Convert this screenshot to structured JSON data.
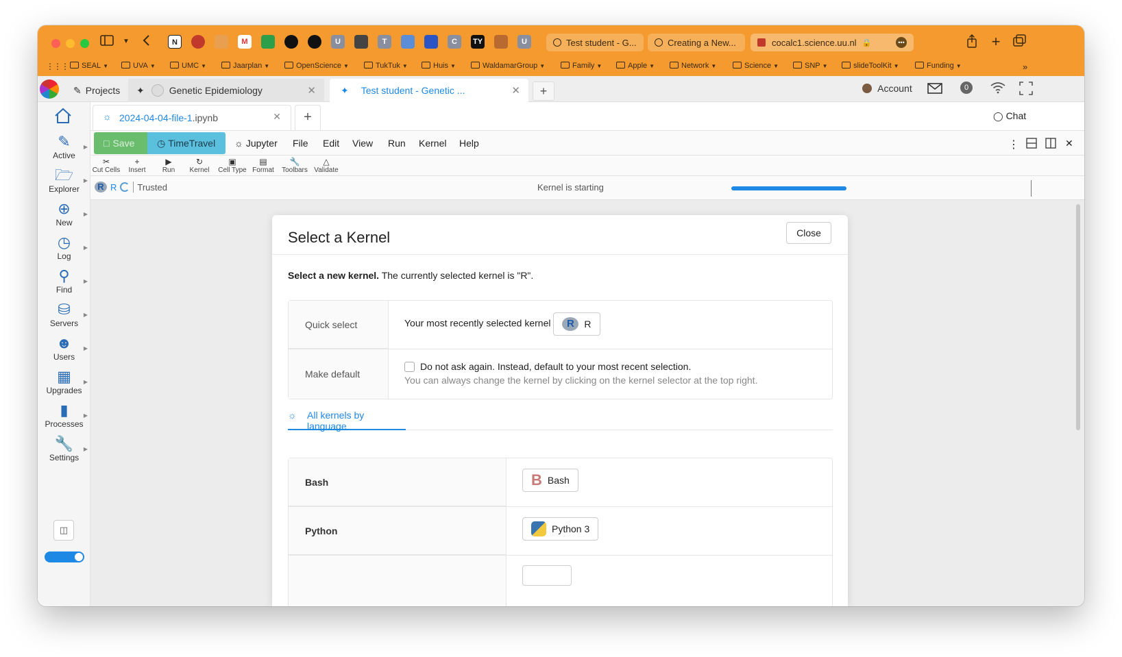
{
  "browser": {
    "tabs": [
      {
        "label": "Test student - G..."
      },
      {
        "label": "Creating a New..."
      },
      {
        "label": "cocalc1.science.uu.nl"
      }
    ],
    "favicons": [
      "N",
      "G",
      "M",
      "U",
      "T",
      "C",
      "TY",
      "U"
    ],
    "bookmarks": [
      "SEAL",
      "UVA",
      "UMC",
      "Jaarplan",
      "OpenScience",
      "TukTuk",
      "Huis",
      "WaldamarGroup",
      "Family",
      "Apple",
      "Network",
      "Science",
      "SNP",
      "slideToolKit",
      "Funding"
    ]
  },
  "cocalc": {
    "projects_label": "Projects",
    "project_tabs": [
      {
        "label": "Genetic Epidemiology"
      },
      {
        "label": "Test student - Genetic ..."
      }
    ],
    "account_label": "Account",
    "notification_count": "0",
    "chat_label": "Chat"
  },
  "file_tab": {
    "name": "2024-04-04-file-1",
    "ext": ".ipynb"
  },
  "sidebar": {
    "items": [
      {
        "label": "Active"
      },
      {
        "label": "Explorer"
      },
      {
        "label": "New"
      },
      {
        "label": "Log"
      },
      {
        "label": "Find"
      },
      {
        "label": "Servers"
      },
      {
        "label": "Users"
      },
      {
        "label": "Upgrades"
      },
      {
        "label": "Processes"
      },
      {
        "label": "Settings"
      }
    ]
  },
  "toolbar": {
    "save_label": "Save",
    "timetravel_label": "TimeTravel",
    "jupyter_label": "Jupyter",
    "menus": [
      "File",
      "Edit",
      "View",
      "Run",
      "Kernel",
      "Help"
    ],
    "tools": [
      "Cut Cells",
      "Insert",
      "Run",
      "Kernel",
      "Cell Type",
      "Format",
      "Toolbars",
      "Validate"
    ]
  },
  "status": {
    "kernel_name": "R",
    "trusted_label": "Trusted",
    "kernel_status": "Kernel is starting",
    "progress": 1.0
  },
  "modal": {
    "title": "Select a Kernel",
    "close_label": "Close",
    "intro_bold": "Select a new kernel.",
    "intro_rest": " The currently selected kernel is \"R\".",
    "quick_select_label": "Quick select",
    "quick_select_text": "Your most recently selected kernel",
    "quick_kernel": "R",
    "make_default_label": "Make default",
    "make_default_text": "Do not ask again. Instead, default to your most recent selection.",
    "make_default_hint": "You can always change the kernel by clicking on the kernel selector at the top right.",
    "tab_label": "All kernels by language",
    "languages": [
      {
        "language": "Bash",
        "kernel": "Bash"
      },
      {
        "language": "Python",
        "kernel": "Python 3"
      }
    ]
  },
  "colors": {
    "browser_accent": "#f59a2e",
    "link_blue": "#1e88e5",
    "save_green": "#6bbd6e",
    "timetravel_blue": "#5bc0de"
  }
}
